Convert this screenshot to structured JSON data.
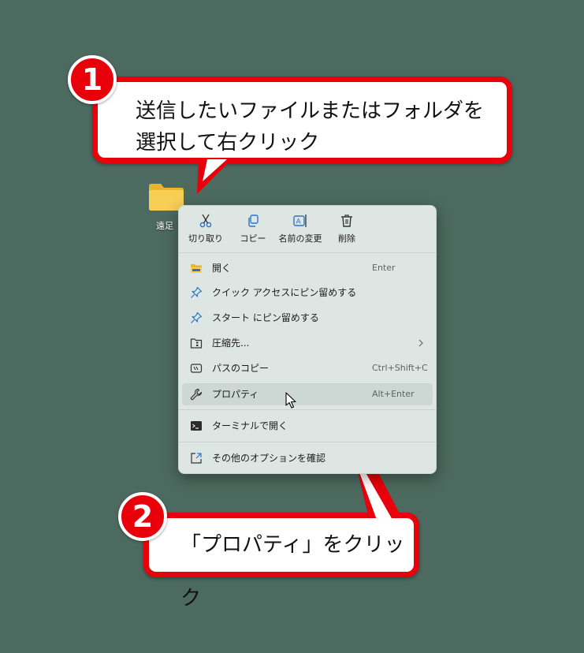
{
  "callouts": [
    {
      "number": "1",
      "lines": [
        "送信したいファイルまたはフォルダを",
        "選択して右クリック"
      ]
    },
    {
      "number": "2",
      "text": "「プロパティ」をクリック"
    }
  ],
  "desktop": {
    "folder_label": "遠足"
  },
  "context_menu": {
    "quick_actions": [
      {
        "icon": "scissors-icon",
        "label": "切り取り"
      },
      {
        "icon": "copy-icon",
        "label": "コピー"
      },
      {
        "icon": "rename-icon",
        "label": "名前の変更"
      },
      {
        "icon": "trash-icon",
        "label": "削除"
      }
    ],
    "items": [
      {
        "icon": "folder-open-icon",
        "label": "開く",
        "shortcut": "Enter"
      },
      {
        "icon": "pin-icon",
        "label": "クイック アクセスにピン留めする",
        "shortcut": ""
      },
      {
        "icon": "pin-icon",
        "label": "スタート にピン留めする",
        "shortcut": ""
      },
      {
        "icon": "compress-icon",
        "label": "圧縮先...",
        "shortcut": "",
        "submenu": true
      },
      {
        "icon": "copy-path-icon",
        "label": "パスのコピー",
        "shortcut": "Ctrl+Shift+C"
      },
      {
        "icon": "wrench-icon",
        "label": "プロパティ",
        "shortcut": "Alt+Enter",
        "highlighted": true
      },
      {
        "icon": "terminal-icon",
        "label": "ターミナルで開く",
        "shortcut": ""
      },
      {
        "icon": "more-options-icon",
        "label": "その他のオプションを確認",
        "shortcut": ""
      }
    ]
  },
  "colors": {
    "desktop_background": "#4c6a5f",
    "callout_red": "#e8000b",
    "menu_background": "#dde6e3",
    "menu_hover": "#cdd7d4",
    "folder_yellow": "#f7c948",
    "icon_blue": "#2b73c8"
  }
}
